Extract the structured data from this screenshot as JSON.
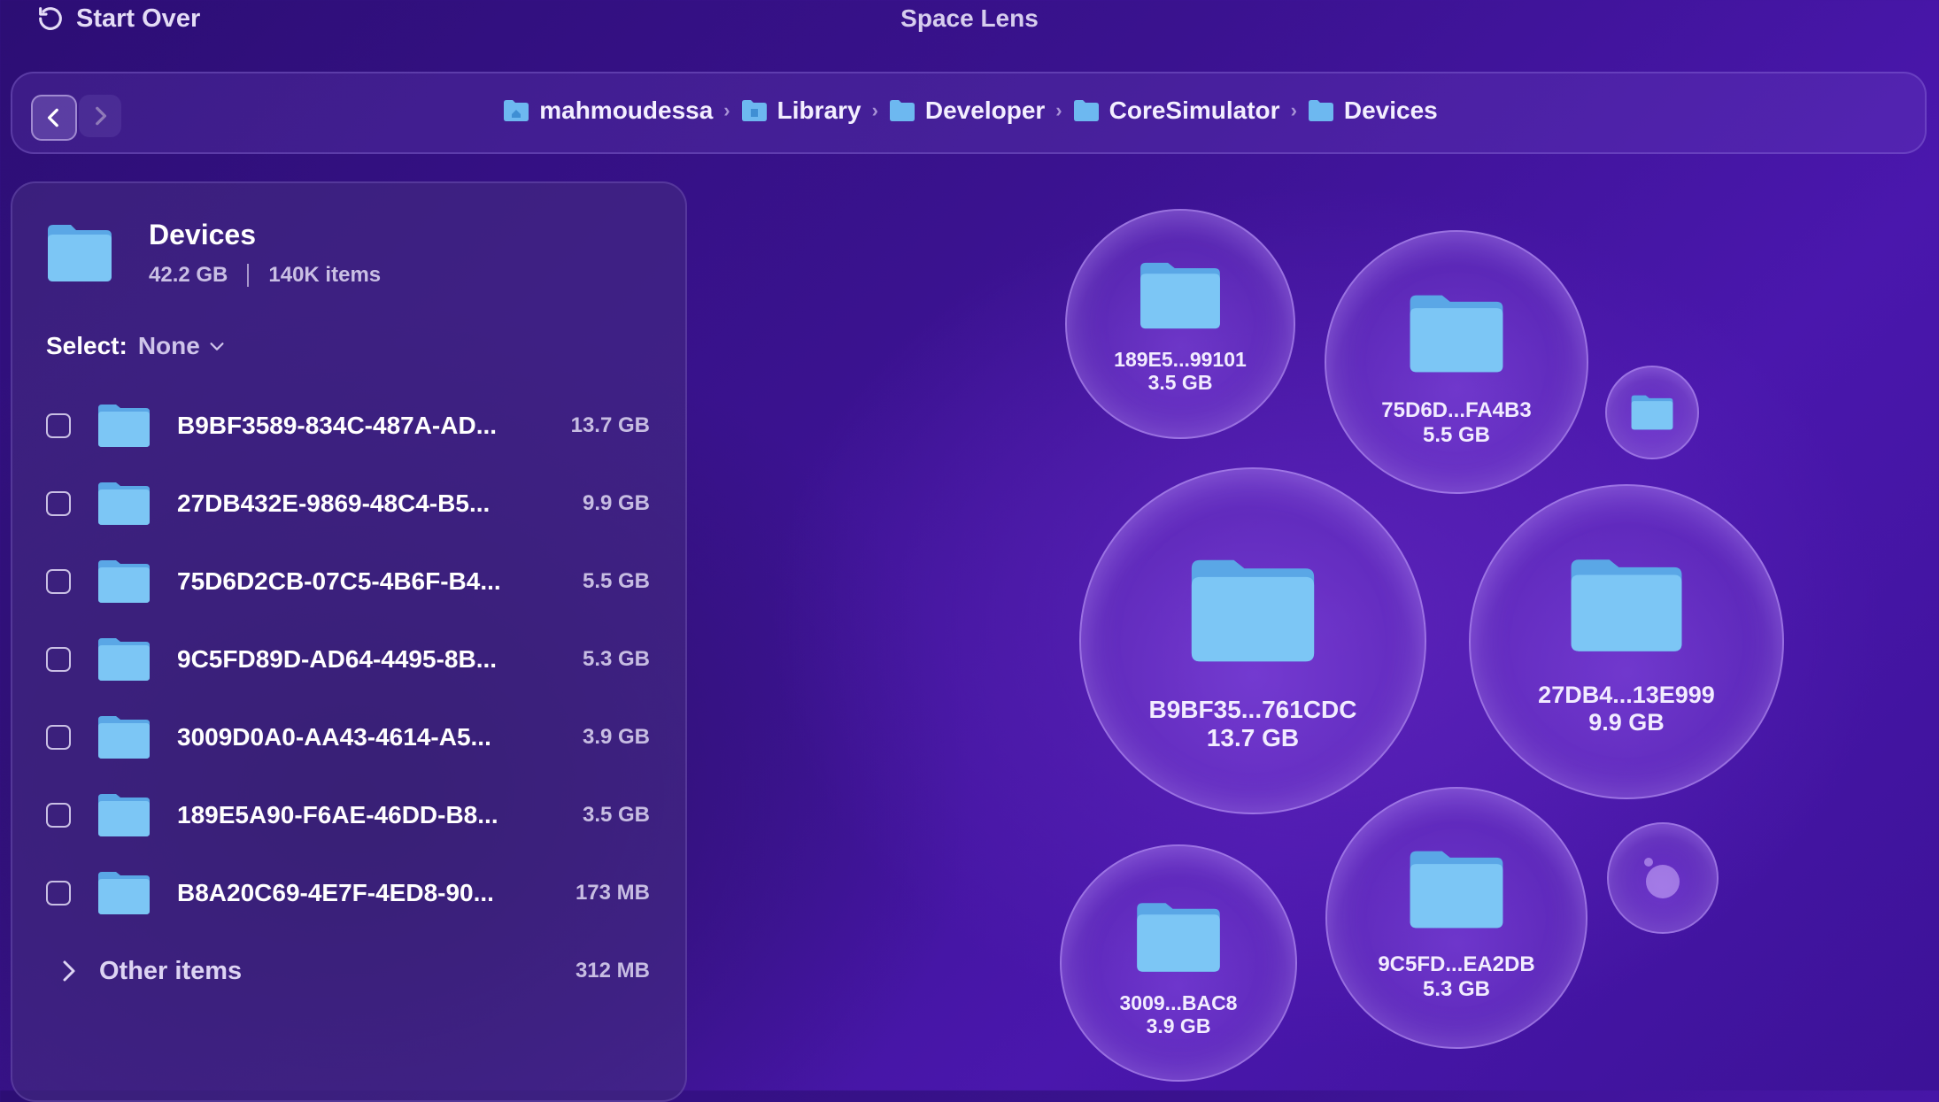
{
  "titlebar": {
    "start_over_label": "Start Over",
    "app_title": "Space Lens"
  },
  "nav": {
    "breadcrumb": [
      "mahmoudessa",
      "Library",
      "Developer",
      "CoreSimulator",
      "Devices"
    ]
  },
  "panel": {
    "title": "Devices",
    "size": "42.2 GB",
    "items_count": "140K items",
    "select_label": "Select:",
    "select_value": "None",
    "items": [
      {
        "name": "B9BF3589-834C-487A-AD...",
        "size": "13.7 GB",
        "checked": false
      },
      {
        "name": "27DB432E-9869-48C4-B5...",
        "size": "9.9 GB",
        "checked": false
      },
      {
        "name": "75D6D2CB-07C5-4B6F-B4...",
        "size": "5.5 GB",
        "checked": false
      },
      {
        "name": "9C5FD89D-AD64-4495-8B...",
        "size": "5.3 GB",
        "checked": false
      },
      {
        "name": "3009D0A0-AA43-4614-A5...",
        "size": "3.9 GB",
        "checked": false
      },
      {
        "name": "189E5A90-F6AE-46DD-B8...",
        "size": "3.5 GB",
        "checked": false
      },
      {
        "name": "B8A20C69-4E7F-4ED8-90...",
        "size": "173 MB",
        "checked": false
      }
    ],
    "other": {
      "label": "Other items",
      "size": "312 MB"
    }
  },
  "bubbles": [
    {
      "name": "189E5...99101",
      "size": "3.5 GB"
    },
    {
      "name": "75D6D...FA4B3",
      "size": "5.5 GB"
    },
    {
      "name": "",
      "size": ""
    },
    {
      "name": "B9BF35...761CDC",
      "size": "13.7 GB"
    },
    {
      "name": "27DB4...13E999",
      "size": "9.9 GB"
    },
    {
      "name": "3009...BAC8",
      "size": "3.9 GB"
    },
    {
      "name": "9C5FD...EA2DB",
      "size": "5.3 GB"
    },
    {
      "name": "",
      "size": ""
    }
  ],
  "colors": {
    "folder_blue": "#7cc6f5",
    "folder_blue_dark": "#5aa7e6",
    "background": "#3a128f"
  }
}
